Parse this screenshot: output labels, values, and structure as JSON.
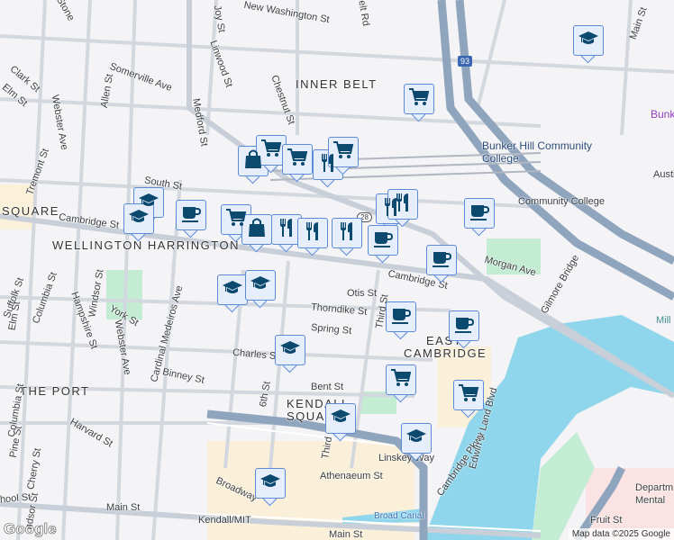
{
  "map": {
    "labels": {
      "stone": "Stone",
      "new_washington": "New Washington St",
      "joy": "Joy St",
      "belt_rd": "Belt Rd",
      "main_top": "Main St",
      "clark": "Clark St",
      "elm_top": "Elm St",
      "somerville": "Somerville Ave",
      "allen": "Allen St",
      "linwood": "Linwood St",
      "inner_belt": "INNER BELT",
      "webster_top": "Webster Ave",
      "medford": "Medford St",
      "chestnut": "Chestnut St",
      "tremont": "Tremont St",
      "south": "South St",
      "square": "SQUARE",
      "cambridge_w": "Cambridge St",
      "wellington": "WELLINGTON HARRINGTON",
      "bunker_hill": "Bunker Hill Community College",
      "bunker_hill_t": "Community College",
      "bunk": "Bunk",
      "austin": "Austi",
      "morgan": "Morgan Ave",
      "gilmore": "Gilmore Bridge",
      "cambridge_e": "Cambridge St",
      "otis": "Otis St",
      "thorndike": "Thorndike St",
      "third_n": "Third St",
      "spring": "Spring St",
      "east_cambridge": "EAST CAMBRIDGE",
      "charles": "Charles St",
      "bent": "Bent St",
      "kendall_sq": "KENDALL SQUARE",
      "binney": "Binney St",
      "linskey": "Linskey Way",
      "athenaeum": "Athenaeum St",
      "third_s": "Third St",
      "edwin": "Edwin H Land Blvd",
      "cambridge_pkwy": "Cambridge Pkwy",
      "broad_canal": "Broad Canal",
      "broadway": "Broadway",
      "main_bottom": "Main St",
      "main_bottom2": "Main St",
      "kendall_mit": "Kendall/MIT",
      "fruit": "Fruit St",
      "dept": "Departm Mental",
      "mill": "Mill",
      "the_port": "THE PORT",
      "harvard": "Harvard St",
      "columbia": "Columbia St",
      "hampshire": "Hampshire St",
      "windsor": "Windsor St",
      "york": "York St",
      "webster_s": "Webster Ave",
      "cardinal": "Cardinal Medeiros Ave",
      "suffolk": "Suffolk St",
      "elm_s": "Elm St",
      "pine": "Pine St",
      "cherry": "Cherry St",
      "columbia_s": "Columbia St",
      "windsor_s": "ndsor St",
      "school": "hool St",
      "sixth": "6th St",
      "i93": "93",
      "r28": "28"
    },
    "attribution": "Map data ©2025 Google",
    "logo": "Google",
    "colors": {
      "water": "#8fd6ec",
      "park": "#c3ecd3",
      "highway": "#8fa4bd",
      "marker_fill": "#e6eefc",
      "marker_border": "#5b8ad8",
      "icon": "#0b4a6e"
    },
    "markers": [
      {
        "icon": "graduation-cap"
      },
      {
        "icon": "shopping-cart"
      },
      {
        "icon": "shopping-bag"
      },
      {
        "icon": "shopping-cart"
      },
      {
        "icon": "shopping-cart"
      },
      {
        "icon": "fork-knife"
      },
      {
        "icon": "shopping-cart"
      },
      {
        "icon": "graduation-cap"
      },
      {
        "icon": "graduation-cap"
      },
      {
        "icon": "coffee-cup"
      },
      {
        "icon": "shopping-cart"
      },
      {
        "icon": "shopping-bag"
      },
      {
        "icon": "fork-knife"
      },
      {
        "icon": "fork-knife"
      },
      {
        "icon": "fork-knife"
      },
      {
        "icon": "fork-knife"
      },
      {
        "icon": "fork-knife"
      },
      {
        "icon": "coffee-cup"
      },
      {
        "icon": "coffee-cup"
      },
      {
        "icon": "coffee-cup"
      },
      {
        "icon": "graduation-cap"
      },
      {
        "icon": "graduation-cap"
      },
      {
        "icon": "coffee-cup"
      },
      {
        "icon": "coffee-cup"
      },
      {
        "icon": "graduation-cap"
      },
      {
        "icon": "shopping-cart"
      },
      {
        "icon": "shopping-cart"
      },
      {
        "icon": "graduation-cap"
      },
      {
        "icon": "graduation-cap"
      },
      {
        "icon": "graduation-cap"
      }
    ]
  }
}
